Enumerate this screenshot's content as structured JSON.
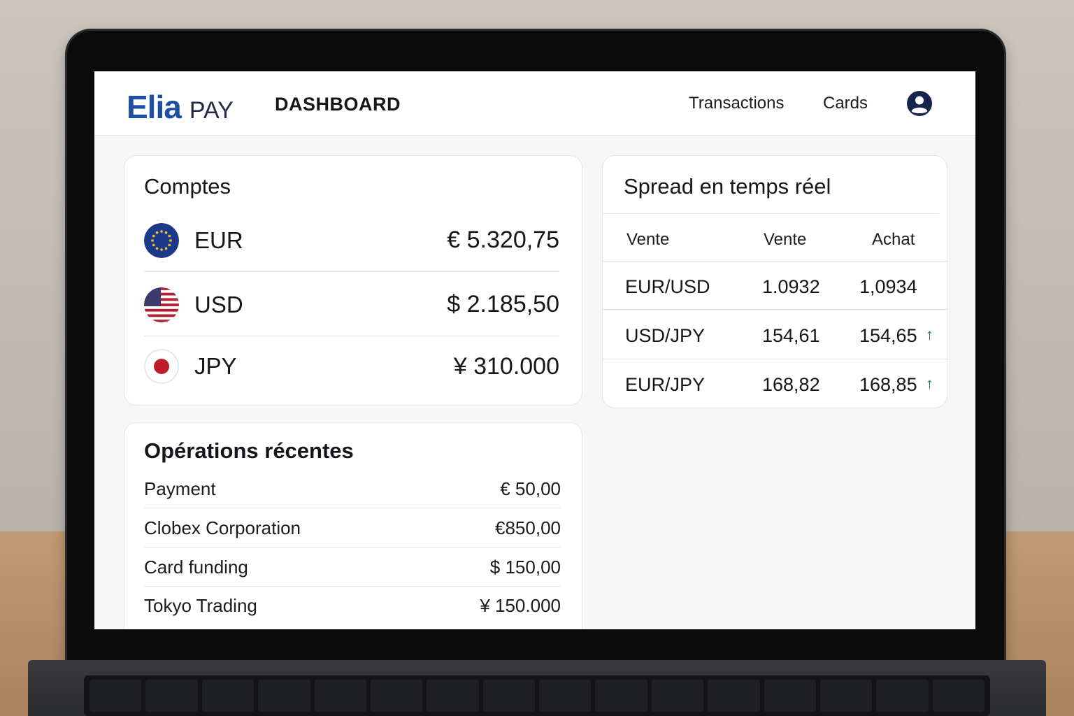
{
  "brand": {
    "name": "Elia",
    "suffix": "PAY",
    "color": "#1d4fa3"
  },
  "header": {
    "title": "DASHBOARD",
    "nav": [
      {
        "label": "Transactions"
      },
      {
        "label": "Cards"
      }
    ],
    "profile_icon": "user-circle-icon"
  },
  "accounts": {
    "title": "Comptes",
    "items": [
      {
        "code": "EUR",
        "balance": "€ 5.320,75",
        "flag": "eu-flag-icon"
      },
      {
        "code": "USD",
        "balance": "$ 2.185,50",
        "flag": "us-flag-icon"
      },
      {
        "code": "JPY",
        "balance": "¥ 310.000",
        "flag": "jp-flag-icon"
      }
    ]
  },
  "operations": {
    "title": "Opérations récentes",
    "items": [
      {
        "label": "Payment",
        "amount": "€ 50,00"
      },
      {
        "label": "Clobex Corporation",
        "amount": "€850,00"
      },
      {
        "label": "Card funding",
        "amount": "$ 150,00"
      },
      {
        "label": "Tokyo Trading",
        "amount": "¥ 150.000"
      }
    ]
  },
  "spread": {
    "title": "Spread en temps réel",
    "columns": [
      "Vente",
      "Vente",
      "Achat"
    ],
    "rows": [
      {
        "pair": "EUR/USD",
        "sell": "1.0932",
        "buy": "1,0934",
        "trend": ""
      },
      {
        "pair": "USD/JPY",
        "sell": "154,61",
        "buy": "154,65",
        "trend": "↑"
      },
      {
        "pair": "EUR/JPY",
        "sell": "168,82",
        "buy": "168,85",
        "trend": "↑"
      }
    ],
    "trend_color": "#1b7a3a"
  }
}
